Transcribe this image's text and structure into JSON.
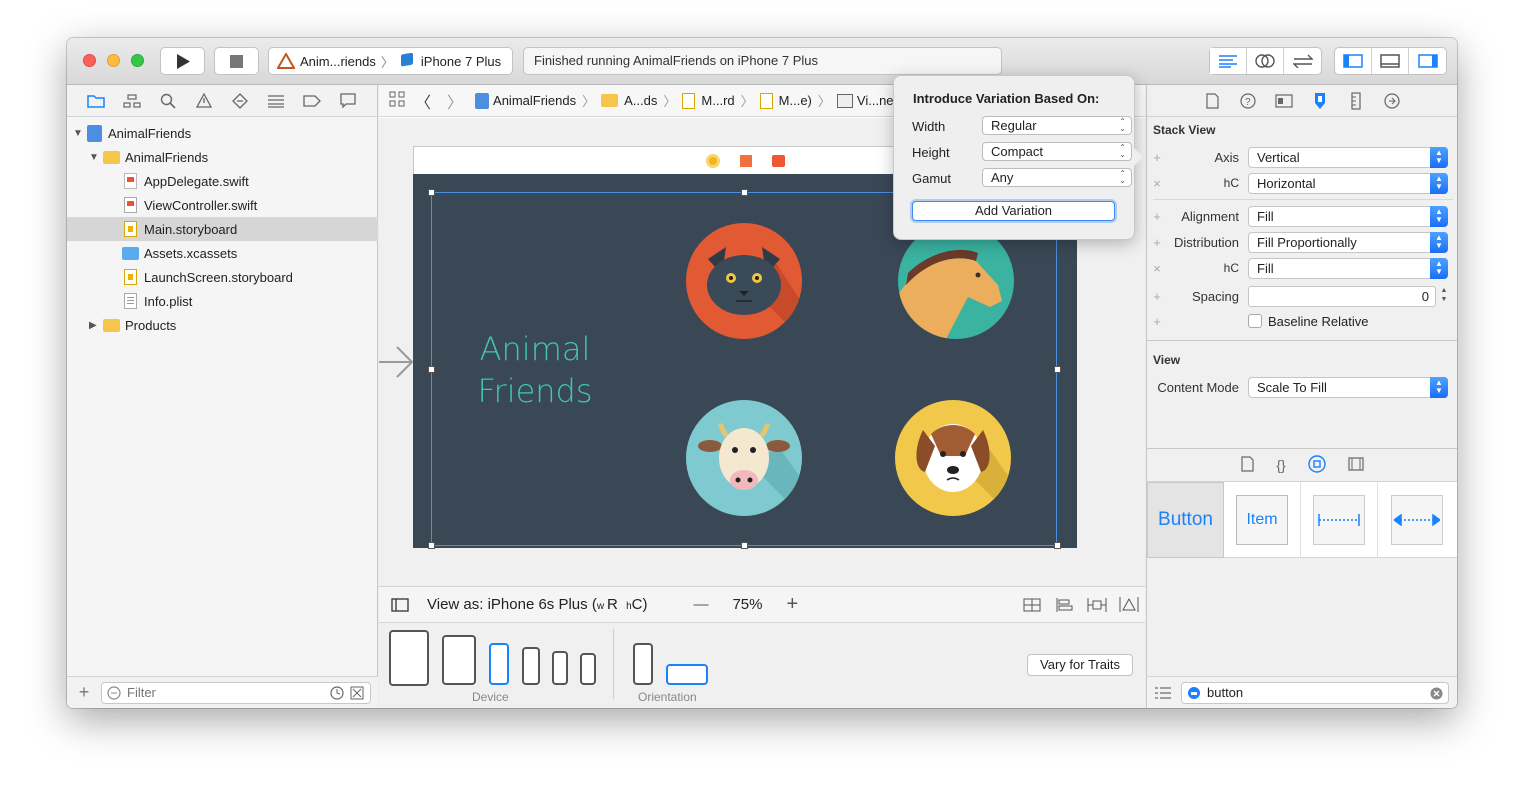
{
  "window": {
    "scheme_target": "Anim...riends",
    "device": "iPhone 7 Plus",
    "activity_status": "Finished running AnimalFriends on iPhone 7 Plus"
  },
  "navigator": {
    "tree": [
      {
        "label": "AnimalFriends",
        "kind": "project",
        "level": 0
      },
      {
        "label": "AnimalFriends",
        "kind": "folder",
        "level": 1
      },
      {
        "label": "AppDelegate.swift",
        "kind": "swift",
        "level": 2
      },
      {
        "label": "ViewController.swift",
        "kind": "swift",
        "level": 2
      },
      {
        "label": "Main.storyboard",
        "kind": "storyboard",
        "level": 2,
        "selected": true
      },
      {
        "label": "Assets.xcassets",
        "kind": "assets",
        "level": 2
      },
      {
        "label": "LaunchScreen.storyboard",
        "kind": "storyboard",
        "level": 2
      },
      {
        "label": "Info.plist",
        "kind": "plist",
        "level": 2
      },
      {
        "label": "Products",
        "kind": "folder",
        "level": 1
      }
    ],
    "filter_placeholder": "Filter"
  },
  "jumpbar": {
    "crumbs": [
      "AnimalFriends",
      "A...ds",
      "M...rd",
      "M...e)",
      "Vi...ne"
    ]
  },
  "scene": {
    "title_line1": "Animal",
    "title_line2": "Friends",
    "title_color": "#3fc8b0",
    "background": "#3a4856",
    "animals": [
      "cat",
      "horse",
      "cow",
      "dog"
    ]
  },
  "bottombar": {
    "view_as": "View as: iPhone 6s Plus (",
    "size_class_w": "w",
    "size_class_w_val": "R",
    "size_class_h": "h",
    "size_class_h_val": "C)",
    "zoom_minus": "—",
    "zoom": "75%",
    "zoom_plus": "+"
  },
  "devicebar": {
    "device_label": "Device",
    "orientation_label": "Orientation",
    "vary_button": "Vary for Traits"
  },
  "popover": {
    "title": "Introduce Variation Based On:",
    "rows": [
      {
        "label": "Width",
        "value": "Regular"
      },
      {
        "label": "Height",
        "value": "Compact"
      },
      {
        "label": "Gamut",
        "value": "Any"
      }
    ],
    "button": "Add Variation"
  },
  "inspector": {
    "stack_view_title": "Stack View",
    "axis_label": "Axis",
    "axis_value": "Vertical",
    "axis_hc_label": "hC",
    "axis_hc_value": "Horizontal",
    "alignment_label": "Alignment",
    "alignment_value": "Fill",
    "distribution_label": "Distribution",
    "distribution_value": "Fill Proportionally",
    "alignment_hc_label": "hC",
    "alignment_hc_value": "Fill",
    "spacing_label": "Spacing",
    "spacing_value": "0",
    "baseline_label": "Baseline Relative",
    "view_title": "View",
    "content_mode_label": "Content Mode",
    "content_mode_value": "Scale To Fill"
  },
  "library": {
    "items": [
      "Button",
      "Item"
    ],
    "search_value": "button"
  }
}
